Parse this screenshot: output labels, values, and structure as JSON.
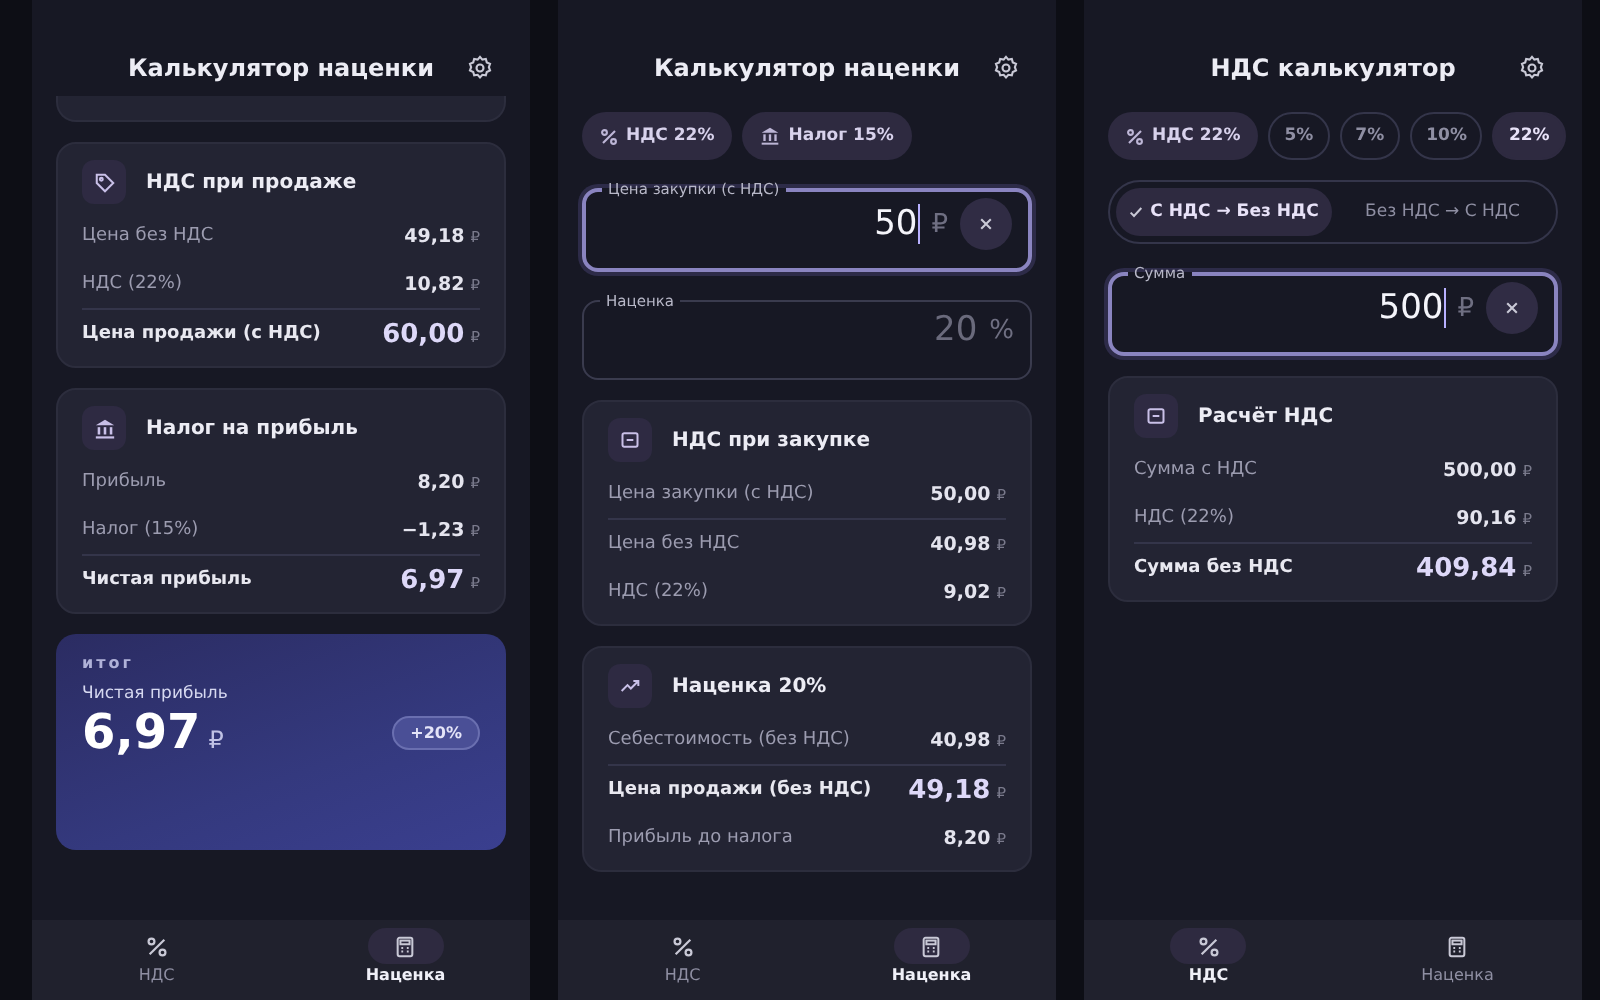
{
  "screens": [
    {
      "title": "Калькулятор наценки",
      "sections": [
        {
          "kind": "stub"
        },
        {
          "kind": "card",
          "title": "НДС при продаже",
          "rows": [
            {
              "label": "Цена без НДС",
              "value": "49,18",
              "currency": "₽",
              "total": false,
              "divider": false
            },
            {
              "label": "НДС (22%)",
              "value": "10,82",
              "currency": "₽",
              "total": false,
              "divider": false
            },
            {
              "label": "Цена продажи (с НДС)",
              "value": "60,00",
              "currency": "₽",
              "total": true,
              "divider": true
            }
          ]
        },
        {
          "kind": "card",
          "title": "Налог на прибыль",
          "rows": [
            {
              "label": "Прибыль",
              "value": "8,20",
              "currency": "₽",
              "total": false,
              "divider": false
            },
            {
              "label": "Налог (15%)",
              "value": "−1,23",
              "currency": "₽",
              "total": false,
              "divider": false
            },
            {
              "label": "Чистая прибыль",
              "value": "6,97",
              "currency": "₽",
              "total": true,
              "divider": true
            }
          ]
        },
        {
          "kind": "summary",
          "caption": "итог",
          "label": "Чистая прибыль",
          "amount": "6,97",
          "currency": "₽",
          "badge": "+20%"
        }
      ],
      "nav": [
        {
          "label": "НДС",
          "selected": false
        },
        {
          "label": "Наценка",
          "selected": true
        }
      ]
    },
    {
      "title": "Калькулятор наценки",
      "sections": [
        {
          "kind": "chips",
          "items": [
            {
              "kind": "info",
              "label": "НДС 22%"
            },
            {
              "kind": "info",
              "label": "Налог 15%"
            }
          ]
        },
        {
          "kind": "field",
          "label": "Цена закупки (с НДС)",
          "value": "50",
          "unit": "₽",
          "focused": true,
          "clearable": true
        },
        {
          "kind": "field",
          "label": "Наценка",
          "placeholder": "20",
          "unit": "%",
          "focused": false,
          "clearable": false
        },
        {
          "kind": "card",
          "title": "НДС при закупке",
          "rows": [
            {
              "label": "Цена закупки (с НДС)",
              "value": "50,00",
              "currency": "₽",
              "total": false,
              "divider": false
            },
            {
              "label": "Цена без НДС",
              "value": "40,98",
              "currency": "₽",
              "total": false,
              "divider": true
            },
            {
              "label": "НДС (22%)",
              "value": "9,02",
              "currency": "₽",
              "total": false,
              "divider": false
            }
          ]
        },
        {
          "kind": "card",
          "title": "Наценка 20%",
          "rows": [
            {
              "label": "Себестоимость (без НДС)",
              "value": "40,98",
              "currency": "₽",
              "total": false,
              "divider": false
            },
            {
              "label": "Цена продажи (без НДС)",
              "value": "49,18",
              "currency": "₽",
              "total": true,
              "divider": true
            },
            {
              "label": "Прибыль до налога",
              "value": "8,20",
              "currency": "₽",
              "total": false,
              "divider": false
            }
          ]
        }
      ],
      "nav": [
        {
          "label": "НДС",
          "selected": false
        },
        {
          "label": "Наценка",
          "selected": true
        }
      ]
    },
    {
      "title": "НДС калькулятор",
      "sections": [
        {
          "kind": "chips",
          "items": [
            {
              "kind": "info",
              "label": "НДС 22%"
            },
            {
              "kind": "option",
              "label": "5%",
              "selected": false
            },
            {
              "kind": "option",
              "label": "7%",
              "selected": false
            },
            {
              "kind": "option",
              "label": "10%",
              "selected": false
            },
            {
              "kind": "option",
              "label": "22%",
              "selected": true
            }
          ]
        },
        {
          "kind": "toggle",
          "options": [
            {
              "label": "С НДС → Без НДС",
              "selected": true
            },
            {
              "label": "Без НДС → С НДС",
              "selected": false
            }
          ]
        },
        {
          "kind": "field",
          "label": "Сумма",
          "value": "500",
          "unit": "₽",
          "focused": true,
          "clearable": true
        },
        {
          "kind": "card",
          "title": "Расчёт НДС",
          "rows": [
            {
              "label": "Сумма с НДС",
              "value": "500,00",
              "currency": "₽",
              "total": false,
              "divider": false
            },
            {
              "label": "НДС (22%)",
              "value": "90,16",
              "currency": "₽",
              "total": false,
              "divider": false
            },
            {
              "label": "Сумма без НДС",
              "value": "409,84",
              "currency": "₽",
              "total": true,
              "divider": true
            }
          ]
        }
      ],
      "nav": [
        {
          "label": "НДС",
          "selected": true
        },
        {
          "label": "Наценка",
          "selected": false
        }
      ]
    }
  ]
}
